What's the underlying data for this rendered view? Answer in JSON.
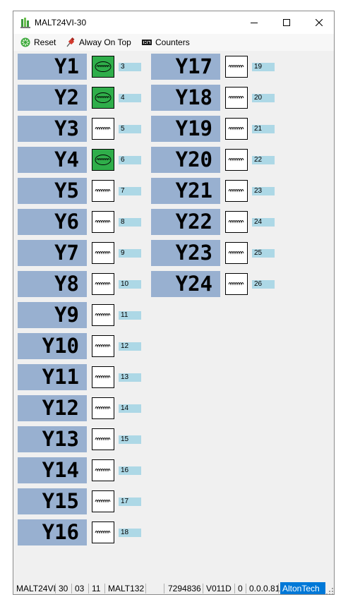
{
  "window": {
    "title": "MALT24VI-30"
  },
  "toolbar": {
    "reset_label": "Reset",
    "always_on_top_label": "Alway On Top",
    "counters_label": "Counters"
  },
  "relays": [
    {
      "label": "Y1",
      "number": "3",
      "state": "on"
    },
    {
      "label": "Y2",
      "number": "4",
      "state": "on"
    },
    {
      "label": "Y3",
      "number": "5",
      "state": "off"
    },
    {
      "label": "Y4",
      "number": "6",
      "state": "on"
    },
    {
      "label": "Y5",
      "number": "7",
      "state": "off"
    },
    {
      "label": "Y6",
      "number": "8",
      "state": "off"
    },
    {
      "label": "Y7",
      "number": "9",
      "state": "off"
    },
    {
      "label": "Y8",
      "number": "10",
      "state": "off"
    },
    {
      "label": "Y9",
      "number": "11",
      "state": "off"
    },
    {
      "label": "Y10",
      "number": "12",
      "state": "off"
    },
    {
      "label": "Y11",
      "number": "13",
      "state": "off"
    },
    {
      "label": "Y12",
      "number": "14",
      "state": "off"
    },
    {
      "label": "Y13",
      "number": "15",
      "state": "off"
    },
    {
      "label": "Y14",
      "number": "16",
      "state": "off"
    },
    {
      "label": "Y15",
      "number": "17",
      "state": "off"
    },
    {
      "label": "Y16",
      "number": "18",
      "state": "off"
    },
    {
      "label": "Y17",
      "number": "19",
      "state": "off"
    },
    {
      "label": "Y18",
      "number": "20",
      "state": "off"
    },
    {
      "label": "Y19",
      "number": "21",
      "state": "off"
    },
    {
      "label": "Y20",
      "number": "22",
      "state": "off"
    },
    {
      "label": "Y21",
      "number": "23",
      "state": "off"
    },
    {
      "label": "Y22",
      "number": "24",
      "state": "off"
    },
    {
      "label": "Y23",
      "number": "25",
      "state": "off"
    },
    {
      "label": "Y24",
      "number": "26",
      "state": "off"
    }
  ],
  "statusbar": {
    "model": "MALT24VI",
    "field2": "30",
    "field3": "03",
    "field4": "11",
    "field5": "MALT132",
    "field6": "",
    "serial": "7294836",
    "version": "V011D",
    "field9": "0",
    "app_version": "0.0.0.81",
    "brand": "AltonTech"
  },
  "colors": {
    "label_bg": "#98b0d0",
    "coil_on": "#2fae4a",
    "coil_off": "#ffffff",
    "number_bg": "#add8e6",
    "brand_bg": "#0078d7"
  },
  "icons": {
    "reset": "reset-gear-icon",
    "always_on_top": "pushpin-icon",
    "counters": "counter-display-icon",
    "coil_off": "coil-winding-icon",
    "coil_on": "coil-energized-icon"
  }
}
